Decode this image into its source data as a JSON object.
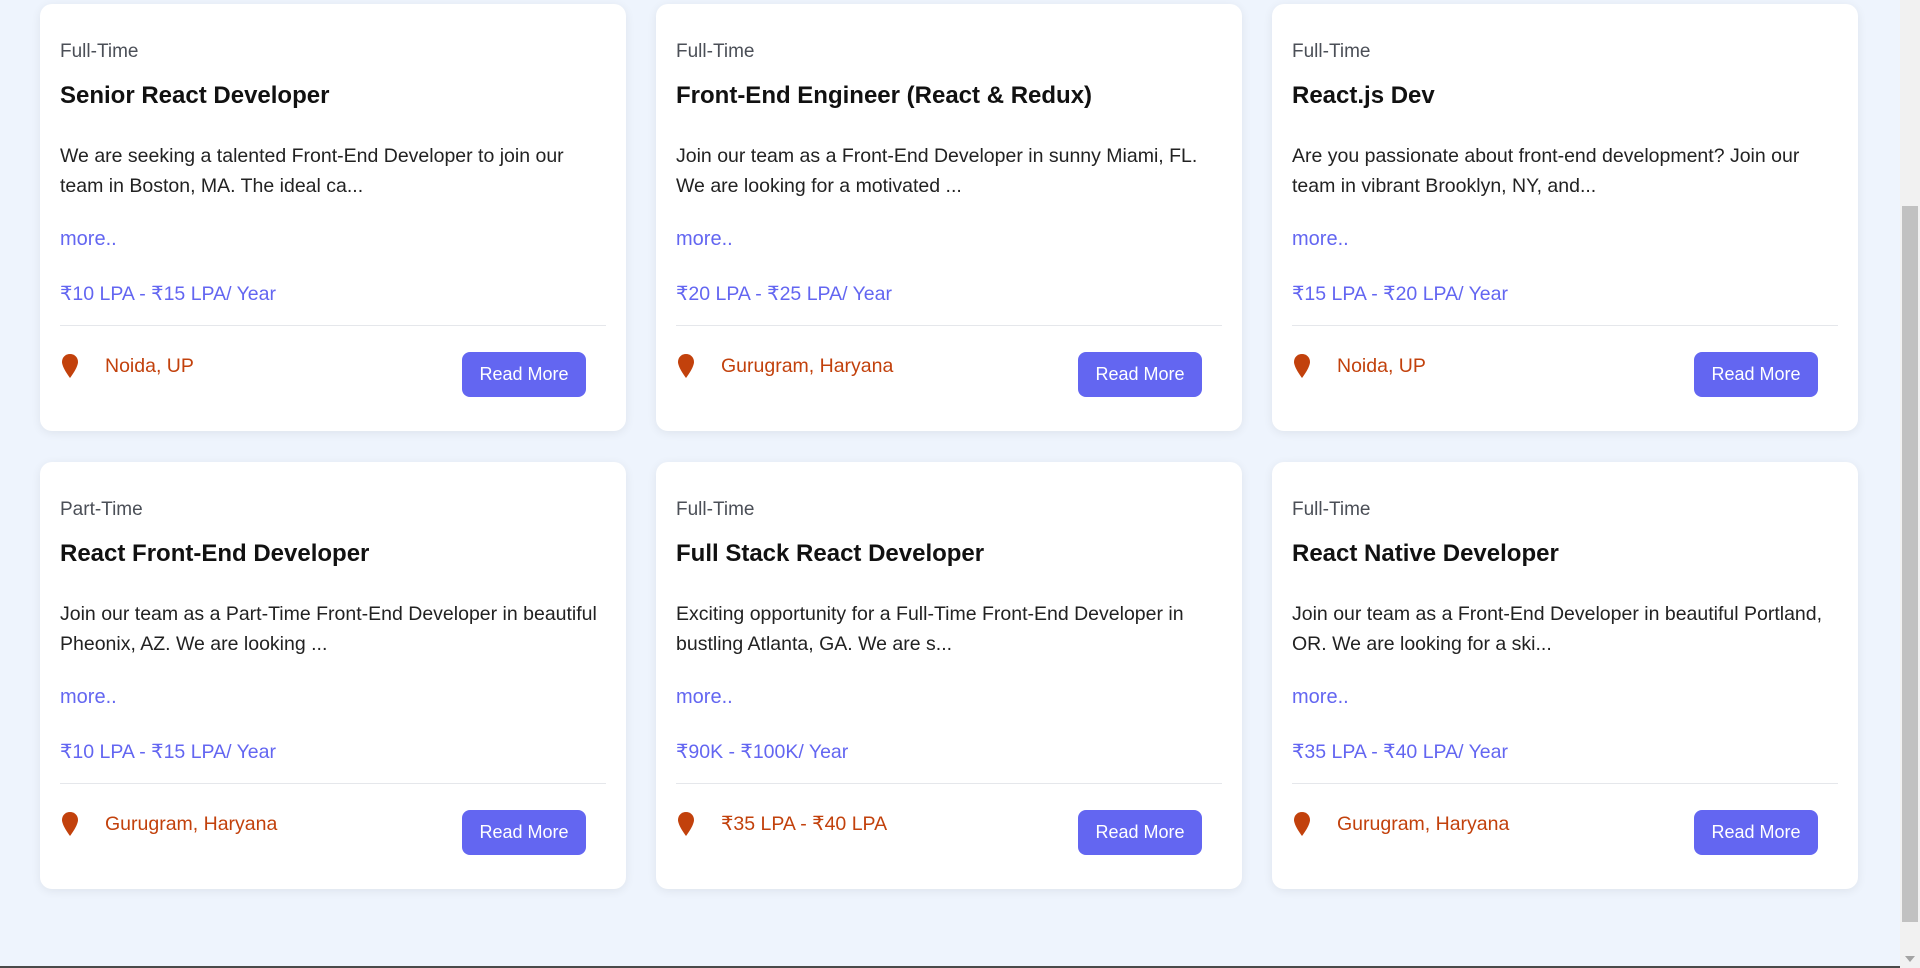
{
  "jobs": [
    {
      "type": "Full-Time",
      "title": "Senior React Developer",
      "description": "We are seeking a talented Front-End Developer to join our team in Boston, MA. The ideal ca...",
      "more": "more..",
      "salary": "₹10 LPA - ₹15 LPA/ Year",
      "location": "Noida, UP",
      "button": "Read More"
    },
    {
      "type": "Full-Time",
      "title": "Front-End Engineer (React & Redux)",
      "description": "Join our team as a Front-End Developer in sunny Miami, FL. We are looking for a motivated ...",
      "more": "more..",
      "salary": "₹20 LPA - ₹25 LPA/ Year",
      "location": "Gurugram, Haryana",
      "button": "Read More"
    },
    {
      "type": "Full-Time",
      "title": "React.js Dev",
      "description": "Are you passionate about front-end development? Join our team in vibrant Brooklyn, NY, and...",
      "more": "more..",
      "salary": "₹15 LPA - ₹20 LPA/ Year",
      "location": "Noida, UP",
      "button": "Read More"
    },
    {
      "type": "Part-Time",
      "title": "React Front-End Developer",
      "description": "Join our team as a Part-Time Front-End Developer in beautiful Pheonix, AZ. We are looking ...",
      "more": "more..",
      "salary": "₹10 LPA - ₹15 LPA/ Year",
      "location": "Gurugram, Haryana",
      "button": "Read More"
    },
    {
      "type": "Full-Time",
      "title": "Full Stack React Developer",
      "description": "Exciting opportunity for a Full-Time Front-End Developer in bustling Atlanta, GA. We are s...",
      "more": "more..",
      "salary": "₹90K - ₹100K/ Year",
      "location": "₹35 LPA - ₹40 LPA",
      "button": "Read More"
    },
    {
      "type": "Full-Time",
      "title": "React Native Developer",
      "description": "Join our team as a Front-End Developer in beautiful Portland, OR. We are looking for a ski...",
      "more": "more..",
      "salary": "₹35 LPA - ₹40 LPA/ Year",
      "location": "Gurugram, Haryana",
      "button": "Read More"
    }
  ],
  "colors": {
    "page_background": "#eef4fd",
    "accent": "#6366f1",
    "location": "#c2410c"
  },
  "icons": {
    "location": "map-pin-icon"
  }
}
